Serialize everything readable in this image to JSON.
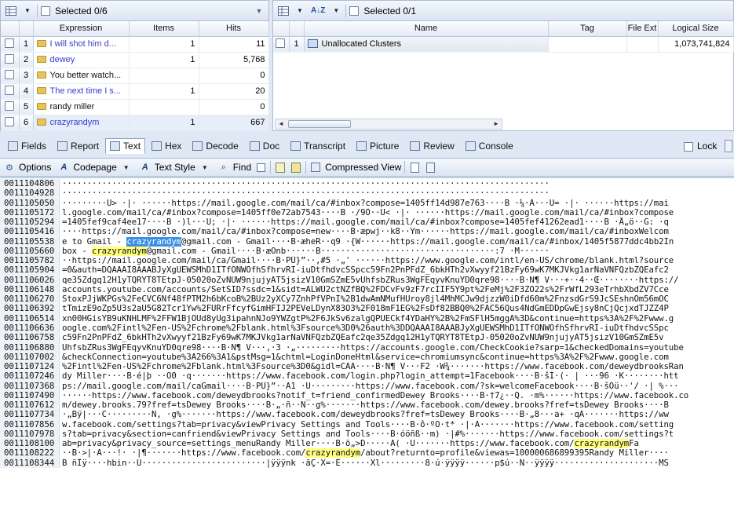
{
  "left_panel": {
    "selected_label": "Selected 0/6",
    "columns": [
      "Expression",
      "Items",
      "Hits"
    ],
    "rows": [
      {
        "n": "1",
        "expr": "I will shot him d...",
        "items": "1",
        "hits": "11",
        "color": "#3b3bd0"
      },
      {
        "n": "2",
        "expr": "dewey",
        "items": "1",
        "hits": "5,768",
        "color": "#3b3bd0"
      },
      {
        "n": "3",
        "expr": "You better watch...",
        "items": "",
        "hits": "0",
        "color": "#111111"
      },
      {
        "n": "4",
        "expr": "The next time I s...",
        "items": "1",
        "hits": "20",
        "color": "#3b3bd0"
      },
      {
        "n": "5",
        "expr": "randy miller",
        "items": "",
        "hits": "0",
        "color": "#111111"
      },
      {
        "n": "6",
        "expr": "crazyrandym",
        "items": "1",
        "hits": "667",
        "color": "#3b3bd0"
      }
    ]
  },
  "right_panel": {
    "selected_label": "Selected 0/1",
    "columns": [
      "Name",
      "Tag",
      "File Ext",
      "Logical Size"
    ],
    "rows": [
      {
        "n": "1",
        "name": "Unallocated Clusters",
        "tag": "",
        "ext": "",
        "size": "1,073,741,824"
      }
    ]
  },
  "view_tabs": [
    {
      "label": "Fields",
      "name": "tab-fields",
      "active": false
    },
    {
      "label": "Report",
      "name": "tab-report",
      "active": false
    },
    {
      "label": "Text",
      "name": "tab-text",
      "active": true
    },
    {
      "label": "Hex",
      "name": "tab-hex",
      "active": false
    },
    {
      "label": "Decode",
      "name": "tab-decode",
      "active": false
    },
    {
      "label": "Doc",
      "name": "tab-doc",
      "active": false
    },
    {
      "label": "Transcript",
      "name": "tab-transcript",
      "active": false
    },
    {
      "label": "Picture",
      "name": "tab-picture",
      "active": false
    },
    {
      "label": "Review",
      "name": "tab-review",
      "active": false
    },
    {
      "label": "Console",
      "name": "tab-console",
      "active": false
    }
  ],
  "lock_label": "Lock",
  "text_toolbar": {
    "options": "Options",
    "codepage": "Codepage",
    "text_style": "Text Style",
    "find": "Find",
    "compressed_view": "Compressed View"
  },
  "icons": {
    "grid": "grid-icon",
    "sort": "sort-az-icon",
    "options": "options-icon",
    "find": "binoculars-icon"
  },
  "highlight_term": "crazyrandym",
  "hex_lines": [
    {
      "off": "0011104806",
      "segs": [
        [
          "··································································································",
          ""
        ]
      ]
    },
    {
      "off": "0011104928",
      "segs": [
        [
          "··································································································",
          ""
        ]
      ]
    },
    {
      "off": "0011105050",
      "segs": [
        [
          "·········U> ·|· ······https://mail.google.com/mail/ca/#inbox?compose=1405ff14d987e763····B ·¼·Á···U= ·|· ······https://mai",
          ""
        ]
      ]
    },
    {
      "off": "0011105172",
      "segs": [
        [
          "l.google.com/mail/ca/#inbox?compose=1405ff0e72ab7543····B ·/9Ô··U< ·|· ······https://mail.google.com/mail/ca/#inbox?compose",
          ""
        ]
      ]
    },
    {
      "off": "0011105294",
      "segs": [
        [
          "=1405fef9caf4ee17····B ·)l···U; ·|· ······https://mail.google.com/mail/ca/#inbox?compose=1405fef41262ead1····B ·Å„ö··G: ·q",
          ""
        ]
      ]
    },
    {
      "off": "0011105416",
      "segs": [
        [
          "····https://mail.google.com/mail/ca/#inbox?compose=new····B·æpwj··k8··Ym······https://mail.google.com/mail/ca/#inboxWelcom",
          ""
        ]
      ]
    },
    {
      "off": "0011105538",
      "segs": [
        [
          "e to Gmail - ",
          ""
        ],
        [
          "crazyrandym",
          "sel"
        ],
        [
          "@gmail.com - Gmail····B·æheR··q9 ·{W······https://mail.google.com/mail/ca/#inbox/1405f5877ddc4bb2In",
          ""
        ]
      ]
    },
    {
      "off": "0011105660",
      "segs": [
        [
          "box - ",
          ""
        ],
        [
          "crazyrandym",
          "hl"
        ],
        [
          "@gmail.com - Gmail····B·æOnb······B···································:7 ·M······",
          ""
        ]
      ]
    },
    {
      "off": "0011105782",
      "segs": [
        [
          "··https://mail.google.com/mail/ca/Gmail····B·PÛ}”··,#5 ·„' ······https://www.google.com/intl/en-US/chrome/blank.html?source",
          ""
        ]
      ]
    },
    {
      "off": "0011105904",
      "segs": [
        [
          "=0&auth=DQAAAI8AAABJyXgUEWSMhD1ITfONWOfhSfhrvRI-iuDtfhdvcSSpcc59Fn2PnPFdZ_6bkHTh2vXwyyf21BzFy69wK7MKJVkg1arNaVNFQzbZQEafc2",
          ""
        ]
      ]
    },
    {
      "off": "0011106026",
      "segs": [
        [
          "qe35Zdgq12H1yTQRYT8TEtpJ-05020oZvNUW9njujyAT5jsizV10GmSZmE5vUhfsbZRus3WgFEqyvKnuYD0qre98····B·N¶ V···+··4··Œ········https://",
          ""
        ]
      ]
    },
    {
      "off": "0011106148",
      "segs": [
        [
          "accounts.youtube.com/accounts/SetSID?ssdc=1&sidt=ALWU2ctNZfBQ%2FDCvFv9zF7rcIIF5Y9pt%2FeMj%2F3ZO22s%2FrWfL293eTrhbXbdZV7Cce",
          ""
        ]
      ]
    },
    {
      "off": "0011106270",
      "segs": [
        [
          "StoxPJjWKPGs%2FeCVC6Nf48fPTM2h6bKcoB%2BUz2yXCy7ZnhPfVPnI%2B1dwAmNMufHUroy8jl4MhMCJw9djzzW0iDfd60m%2FnzsdGrS9JcSEshnOm56mOC",
          ""
        ]
      ]
    },
    {
      "off": "0011106392",
      "segs": [
        [
          "tTmizE9oZp5U3s2aU5G82Tcr1Yw%2FURrFfcyfGimHFIJ2PEVeLDynX83O3%2F018mF1EG%2FsDf82BBQ0%2FAC56Qus4NdGmEDDpGwEjsy8nCjQcjxdTJZZ4P",
          ""
        ]
      ]
    },
    {
      "off": "0011106514",
      "segs": [
        [
          "xn00HGisYB9uKNHLMF%2FFW1BjOUd8yUg3ipahnNJo9YWZgtP%2F6JkSv6zalgQPUECkf4YDaHY%2B%2FmSFlH5mggA%3D&continue=https%3A%2F%2Fwww.g",
          ""
        ]
      ]
    },
    {
      "off": "0011106636",
      "segs": [
        [
          "oogle.com%2Fintl%2Fen-US%2Fchrome%2Fblank.html%3Fsource%3D0%26auth%3DDQAAAI8AAABJyXgUEWSMhD1ITfONWOfhSfhrvRI-iuDtfhdvcSSpc",
          ""
        ]
      ]
    },
    {
      "off": "0011106758",
      "segs": [
        [
          "c59Fn2PnPFdZ_6bkHTh2vXwyyf21BzFy69wK7MKJVkg1arNaVNFQzbZQEafc2qe35Zdgq12H1yTQRYT8TEtpJ-05020oZvNUW9njujyAT5jsizV10GmSZmE5v",
          ""
        ]
      ]
    },
    {
      "off": "0011106880",
      "segs": [
        [
          "UhfsbZRus3WgFEqyvKnuYD0qre98····B·N¶ V···,·3 ·„·········https://accounts.google.com/CheckCookie?sarp=1&checkedDomains=youtube",
          ""
        ]
      ]
    },
    {
      "off": "0011107002",
      "segs": [
        [
          "&checkConnection=youtube%3A266%3A1&pstMsg=1&chtml=LoginDoneHtml&service=chromiumsync&continue=https%3A%2F%2Fwww.google.com",
          ""
        ]
      ]
    },
    {
      "off": "0011107124",
      "segs": [
        [
          "%2Fintl%2Fen-US%2Fchrome%2Fblank.html%3Fsource%3D0&gidl=CAA····B·N¶ V···F2 ·W¾·······https://www.facebook.com/deweydbrooksRan",
          ""
        ]
      ]
    },
    {
      "off": "0011107246",
      "segs": [
        [
          "dy Miller····B·é|þ ··O0 ·q·······https://www.facebook.com/login.php?login_attempt=1Facebook····B·šÍ·(· | ···96 ·K········htt",
          ""
        ]
      ]
    },
    {
      "off": "0011107368",
      "segs": [
        [
          "ps://mail.google.com/mail/caGmail····B·PÛ}”··A1 ·U·········https://www.facebook.com/?sk=welcomeFacebook····B·šÓü··'/ ·| %···",
          ""
        ]
      ]
    },
    {
      "off": "0011107490",
      "segs": [
        [
          "······https://www.facebook.com/deweydbrooks?notif_t=friend_confirmedDewey Brooks····B·†7¿··Q. ·m%······https://www.facebook.co",
          ""
        ]
      ]
    },
    {
      "off": "0011107612",
      "segs": [
        [
          "m/dewey.brooks.79?fref=tsDewey Brooks····B·„·ñ··N··g%·······https://www.facebook.com/dewey.brooks?fref=tsDewey Brooks····B",
          ""
        ]
      ]
    },
    {
      "off": "0011107734",
      "segs": [
        [
          "·„Bÿ|···C·········N, ·g%·······https://www.facebook.com/deweydbrooks?fref=tsDewey Brooks····B·„8···a+ ·qA·······https://ww",
          ""
        ]
      ]
    },
    {
      "off": "0011107856",
      "segs": [
        [
          "w.facebook.com/settings?tab=privacy&viewPrivacy Settings and Tools····B·ô·ºO·t* ·|·A·······https://www.facebook.com/setting",
          ""
        ]
      ]
    },
    {
      "off": "0011107978",
      "segs": [
        [
          "s?tab=privacy&section=canfriend&viewPrivacy Settings and Tools····B·óöñß··m) ·|#%·······https://www.facebook.com/settings?t",
          ""
        ]
      ]
    },
    {
      "off": "0011108100",
      "segs": [
        [
          "ab=privacy&privacy_source=settings_menuRandy Miller····B·ö„>D·····A( ·U·······https://www.facebook.com/",
          ""
        ],
        [
          "crazyrandym",
          "hl"
        ],
        [
          "Fa",
          ""
        ]
      ]
    },
    {
      "off": "0011108222",
      "segs": [
        [
          "··B·>|·A···!· ·|¶·······https://www.facebook.com/",
          ""
        ],
        [
          "crazyrandym",
          "hl"
        ],
        [
          "/about?returnto=profile&viewas=100000686899395Randy Miller····",
          ""
        ]
      ]
    },
    {
      "off": "0011108344",
      "segs": [
        [
          "B ñÎÿ····hbin··Ú·························|ÿÿÿnk ·ãÇ·X=·Ê······Xl·········8·ú·ÿÿÿÿ······p$ú··Ñ··ÿÿÿÿ·····················MS",
          ""
        ]
      ]
    }
  ]
}
